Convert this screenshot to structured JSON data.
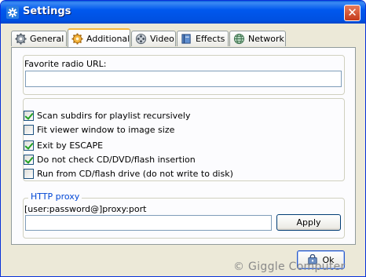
{
  "window": {
    "title": "Settings",
    "close_symbol": "✕"
  },
  "tabs": [
    {
      "label": "General",
      "icon": "gear-icon"
    },
    {
      "label": "Additional",
      "icon": "sun-gear-icon",
      "active": true
    },
    {
      "label": "Video",
      "icon": "film-reel-icon"
    },
    {
      "label": "Effects",
      "icon": "book-icon"
    },
    {
      "label": "Network",
      "icon": "globe-icon"
    }
  ],
  "radio": {
    "label": "Favorite radio URL:",
    "value": ""
  },
  "options": [
    {
      "label": "Scan subdirs for playlist recursively",
      "checked": true
    },
    {
      "label": "Fit viewer window to image size",
      "checked": false
    },
    {
      "label": "Exit by ESCAPE",
      "checked": true
    },
    {
      "label": "Do not check CD/DVD/flash insertion",
      "checked": true
    },
    {
      "label": "Run from CD/flash drive (do not write to disk)",
      "checked": false
    }
  ],
  "proxy": {
    "legend": "HTTP proxy",
    "format_hint": "[user:password@]proxy:port",
    "value": "",
    "apply_label": "Apply"
  },
  "footer": {
    "ok_label": "Ok",
    "watermark": "© Giggle Computer"
  },
  "colors": {
    "title_bar": "#0058ee",
    "active_tab_accent": "#f4b73d",
    "group_legend": "#0046d5",
    "checkmark": "#21a121"
  }
}
